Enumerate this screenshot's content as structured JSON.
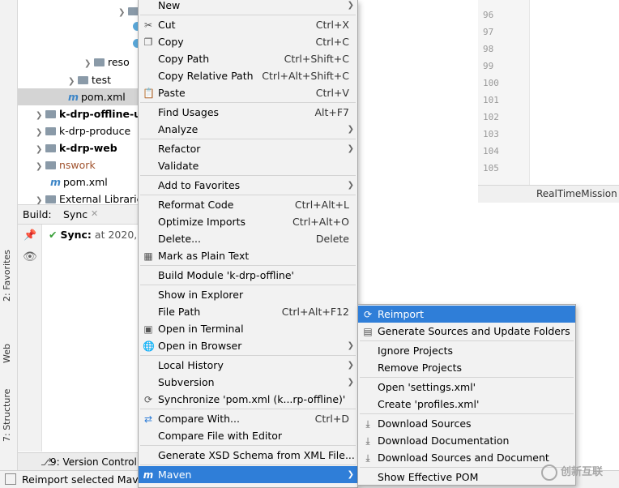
{
  "project_tree": {
    "rows": [
      {
        "label": "",
        "type": "folder"
      },
      {
        "label": "",
        "type": "dot"
      },
      {
        "label": "",
        "type": "dot"
      },
      {
        "label": "reso",
        "type": "folder"
      },
      {
        "label": "test",
        "type": "folder"
      },
      {
        "label": "pom.xml",
        "type": "maven"
      },
      {
        "label": "k-drp-offline-u",
        "type": "module"
      },
      {
        "label": "k-drp-produce",
        "type": "module"
      },
      {
        "label": "k-drp-web",
        "type": "module"
      },
      {
        "label": "nswork",
        "type": "folder"
      },
      {
        "label": "pom.xml",
        "type": "maven"
      },
      {
        "label": "External Libraries",
        "type": "lib"
      }
    ]
  },
  "build_panel": {
    "label": "Build:",
    "tab": "Sync",
    "sync_status": "Sync:",
    "sync_time": "at 2020,"
  },
  "side_tabs": {
    "favorites": "2: Favorites",
    "web": "Web",
    "structure": "7: Structure"
  },
  "bottom": {
    "version_control": "9: Version Control",
    "status": "Reimport selected Mave"
  },
  "editor": {
    "line_numbers": [
      "96",
      "97",
      "98",
      "99",
      "100",
      "101",
      "102",
      "103",
      "104",
      "105"
    ],
    "tab_label": "RealTimeMission"
  },
  "context_menu": {
    "items": [
      {
        "label": "New",
        "shortcut": "",
        "arrow": true,
        "icon": ""
      },
      {
        "label": "Cut",
        "shortcut": "Ctrl+X",
        "arrow": false,
        "icon": "scissors-icon"
      },
      {
        "label": "Copy",
        "shortcut": "Ctrl+C",
        "arrow": false,
        "icon": "copy-icon"
      },
      {
        "label": "Copy Path",
        "shortcut": "Ctrl+Shift+C",
        "arrow": false,
        "icon": ""
      },
      {
        "label": "Copy Relative Path",
        "shortcut": "Ctrl+Alt+Shift+C",
        "arrow": false,
        "icon": ""
      },
      {
        "label": "Paste",
        "shortcut": "Ctrl+V",
        "arrow": false,
        "icon": "paste-icon"
      },
      {
        "label": "Find Usages",
        "shortcut": "Alt+F7",
        "arrow": false,
        "icon": ""
      },
      {
        "label": "Analyze",
        "shortcut": "",
        "arrow": true,
        "icon": ""
      },
      {
        "label": "Refactor",
        "shortcut": "",
        "arrow": true,
        "icon": ""
      },
      {
        "label": "Validate",
        "shortcut": "",
        "arrow": false,
        "icon": ""
      },
      {
        "label": "Add to Favorites",
        "shortcut": "",
        "arrow": true,
        "icon": ""
      },
      {
        "label": "Reformat Code",
        "shortcut": "Ctrl+Alt+L",
        "arrow": false,
        "icon": ""
      },
      {
        "label": "Optimize Imports",
        "shortcut": "Ctrl+Alt+O",
        "arrow": false,
        "icon": ""
      },
      {
        "label": "Delete...",
        "shortcut": "Delete",
        "arrow": false,
        "icon": ""
      },
      {
        "label": "Mark as Plain Text",
        "shortcut": "",
        "arrow": false,
        "icon": "plain-text-icon"
      },
      {
        "label": "Build Module 'k-drp-offline'",
        "shortcut": "",
        "arrow": false,
        "icon": ""
      },
      {
        "label": "Show in Explorer",
        "shortcut": "",
        "arrow": false,
        "icon": ""
      },
      {
        "label": "File Path",
        "shortcut": "Ctrl+Alt+F12",
        "arrow": false,
        "icon": ""
      },
      {
        "label": "Open in Terminal",
        "shortcut": "",
        "arrow": false,
        "icon": "terminal-icon"
      },
      {
        "label": "Open in Browser",
        "shortcut": "",
        "arrow": true,
        "icon": "globe-icon"
      },
      {
        "label": "Local History",
        "shortcut": "",
        "arrow": true,
        "icon": ""
      },
      {
        "label": "Subversion",
        "shortcut": "",
        "arrow": true,
        "icon": ""
      },
      {
        "label": "Synchronize 'pom.xml (k...rp-offline)'",
        "shortcut": "",
        "arrow": false,
        "icon": "sync-icon"
      },
      {
        "label": "Compare With...",
        "shortcut": "Ctrl+D",
        "arrow": false,
        "icon": "compare-icon"
      },
      {
        "label": "Compare File with Editor",
        "shortcut": "",
        "arrow": false,
        "icon": ""
      },
      {
        "label": "Generate XSD Schema from XML File...",
        "shortcut": "",
        "arrow": false,
        "icon": ""
      },
      {
        "label": "Maven",
        "shortcut": "",
        "arrow": true,
        "icon": "maven-icon"
      }
    ]
  },
  "maven_submenu": {
    "items": [
      {
        "label": "Reimport",
        "icon": "reimport-icon"
      },
      {
        "label": "Generate Sources and Update Folders",
        "icon": "generate-icon"
      },
      {
        "label": "Ignore Projects",
        "icon": ""
      },
      {
        "label": "Remove Projects",
        "icon": ""
      },
      {
        "label": "Open 'settings.xml'",
        "icon": ""
      },
      {
        "label": "Create 'profiles.xml'",
        "icon": ""
      },
      {
        "label": "Download Sources",
        "icon": "download-icon"
      },
      {
        "label": "Download Documentation",
        "icon": "download-icon"
      },
      {
        "label": "Download Sources and Document",
        "icon": "download-icon"
      },
      {
        "label": "Show Effective POM",
        "icon": ""
      }
    ]
  },
  "watermark": "创新互联",
  "colors": {
    "highlight": "#2f7ed8",
    "menu_bg": "#f2f2f2"
  }
}
